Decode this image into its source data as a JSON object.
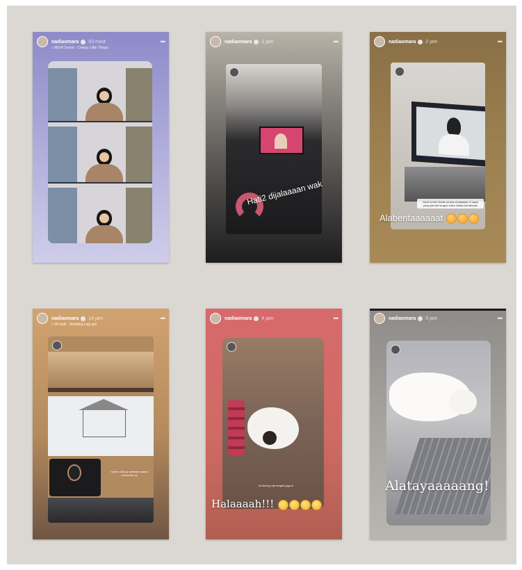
{
  "stories": [
    {
      "username": "nadiaomara",
      "time_ago": "53 minit",
      "subline": "♫ MGW Sound · Creepy Little Things",
      "caption": ""
    },
    {
      "username": "nadiaomara",
      "time_ago": "1 jam",
      "caption": "Hati2 dijalaaaan wak"
    },
    {
      "username": "nadiaomara",
      "time_ago": "2 jam",
      "caption": "Alabentaaaaaat",
      "mini_note": "Ruzil tonton Nadia omara di jalaaaan ni sapa yang pernah tengok video dalam kenderaan"
    },
    {
      "username": "nadiaomara",
      "time_ago": "14 jam",
      "subline": "♫ Mr.Nadi · Wedding Lagi gini",
      "mini_note": "nonton kita ya selamat malam menonton ok"
    },
    {
      "username": "nadiaomara",
      "time_ago": "4 jam",
      "caption": "Halaaaah!!!",
      "mini_note": "Ini kucing nak tengok juga ni"
    },
    {
      "username": "nadiaomara",
      "time_ago": "5 jam",
      "caption": "Alatayaaaaang!"
    }
  ]
}
